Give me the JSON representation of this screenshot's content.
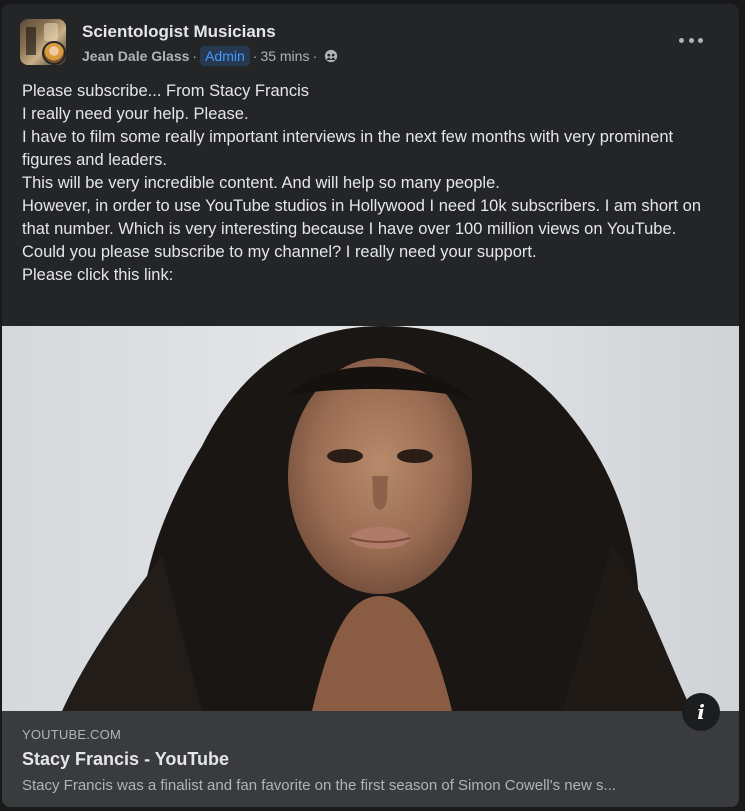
{
  "header": {
    "group_name": "Scientologist Musicians",
    "author": "Jean Dale Glass",
    "sep1": "·",
    "role_badge": "Admin",
    "sep2": "·",
    "timestamp": "35 mins",
    "sep3": "·",
    "audience_icon": "group-audience-icon",
    "more_icon": "more-options-icon"
  },
  "post": {
    "lines": [
      "Please subscribe... From Stacy Francis",
      "I really need your help. Please.",
      "I have to film some really important interviews in the next few months with very prominent figures and leaders.",
      "This will be very incredible content.  And will help so many people.",
      "However, in order to use YouTube studios in Hollywood I need 10k subscribers. I am short on that number. Which is very interesting because I have over 100 million views on YouTube.",
      "Could you please subscribe to my channel? I really need your support.",
      "Please click this link:"
    ]
  },
  "link_preview": {
    "info_glyph": "i",
    "domain": "YOUTUBE.COM",
    "title": "Stacy Francis - YouTube",
    "description": "Stacy Francis was a finalist and fan favorite on the first season of Simon Cowell's new s..."
  },
  "colors": {
    "card_bg": "#242526",
    "link_card_bg": "#3a3b3c",
    "badge_text": "#4599ff",
    "badge_bg": "#263951"
  }
}
